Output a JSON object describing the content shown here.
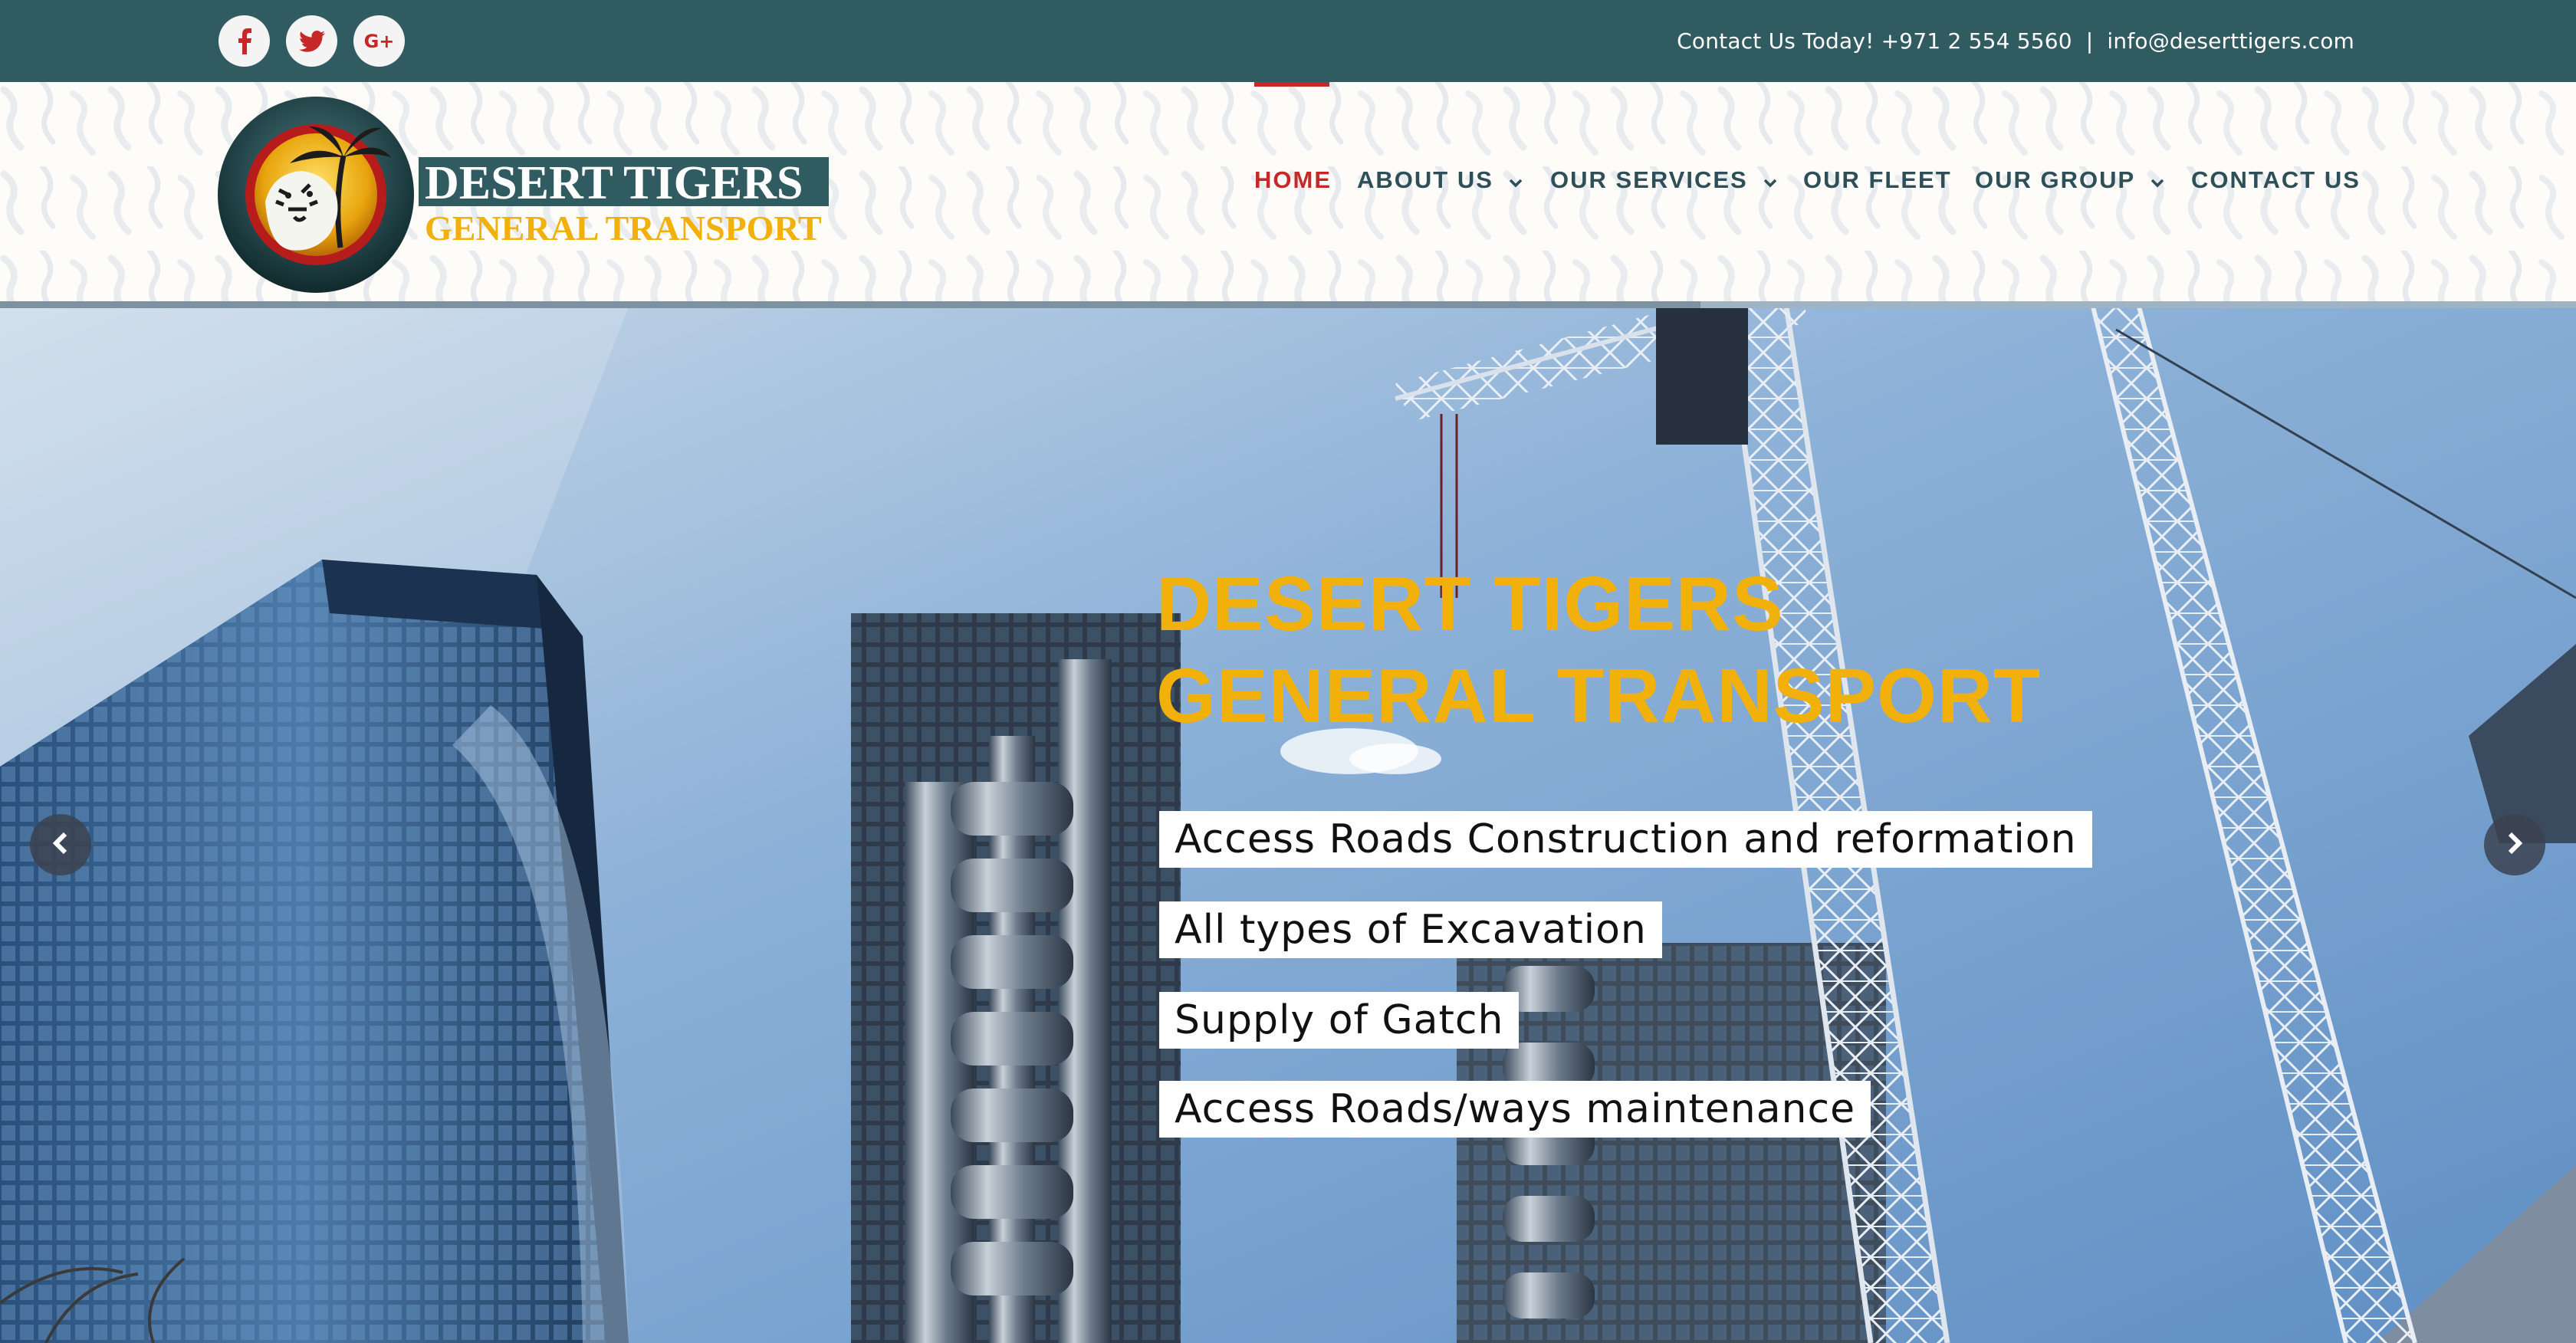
{
  "topbar": {
    "social": [
      {
        "name": "facebook-icon",
        "glyph": "f"
      },
      {
        "name": "twitter-icon",
        "glyph": ""
      },
      {
        "name": "google-plus-icon",
        "glyph": "G+"
      }
    ],
    "contact_text": "Contact Us Today! +971 2 554 5560",
    "separator": "|",
    "email": "info@deserttigers.com"
  },
  "logo": {
    "line1": "DESERT TIGERS",
    "line2": "GENERAL TRANSPORT"
  },
  "nav": {
    "items": [
      {
        "label": "HOME",
        "active": true,
        "dropdown": false
      },
      {
        "label": "ABOUT US",
        "active": false,
        "dropdown": true
      },
      {
        "label": "OUR SERVICES",
        "active": false,
        "dropdown": true
      },
      {
        "label": "OUR FLEET",
        "active": false,
        "dropdown": false
      },
      {
        "label": "OUR GROUP",
        "active": false,
        "dropdown": true
      },
      {
        "label": "CONTACT US",
        "active": false,
        "dropdown": false
      }
    ]
  },
  "slider": {
    "progress": 0.66,
    "title_line1": "DESERT TIGERS",
    "title_line2": "GENERAL TRANSPORT",
    "services": [
      "Access Roads Construction and reformation",
      "All types of Excavation",
      "Supply of Gatch",
      "Access Roads/ways maintenance"
    ]
  },
  "colors": {
    "topbar": "#305c61",
    "accent_red": "#c62828",
    "nav_text": "#2e4f57",
    "hero_title": "#f2b10a"
  }
}
